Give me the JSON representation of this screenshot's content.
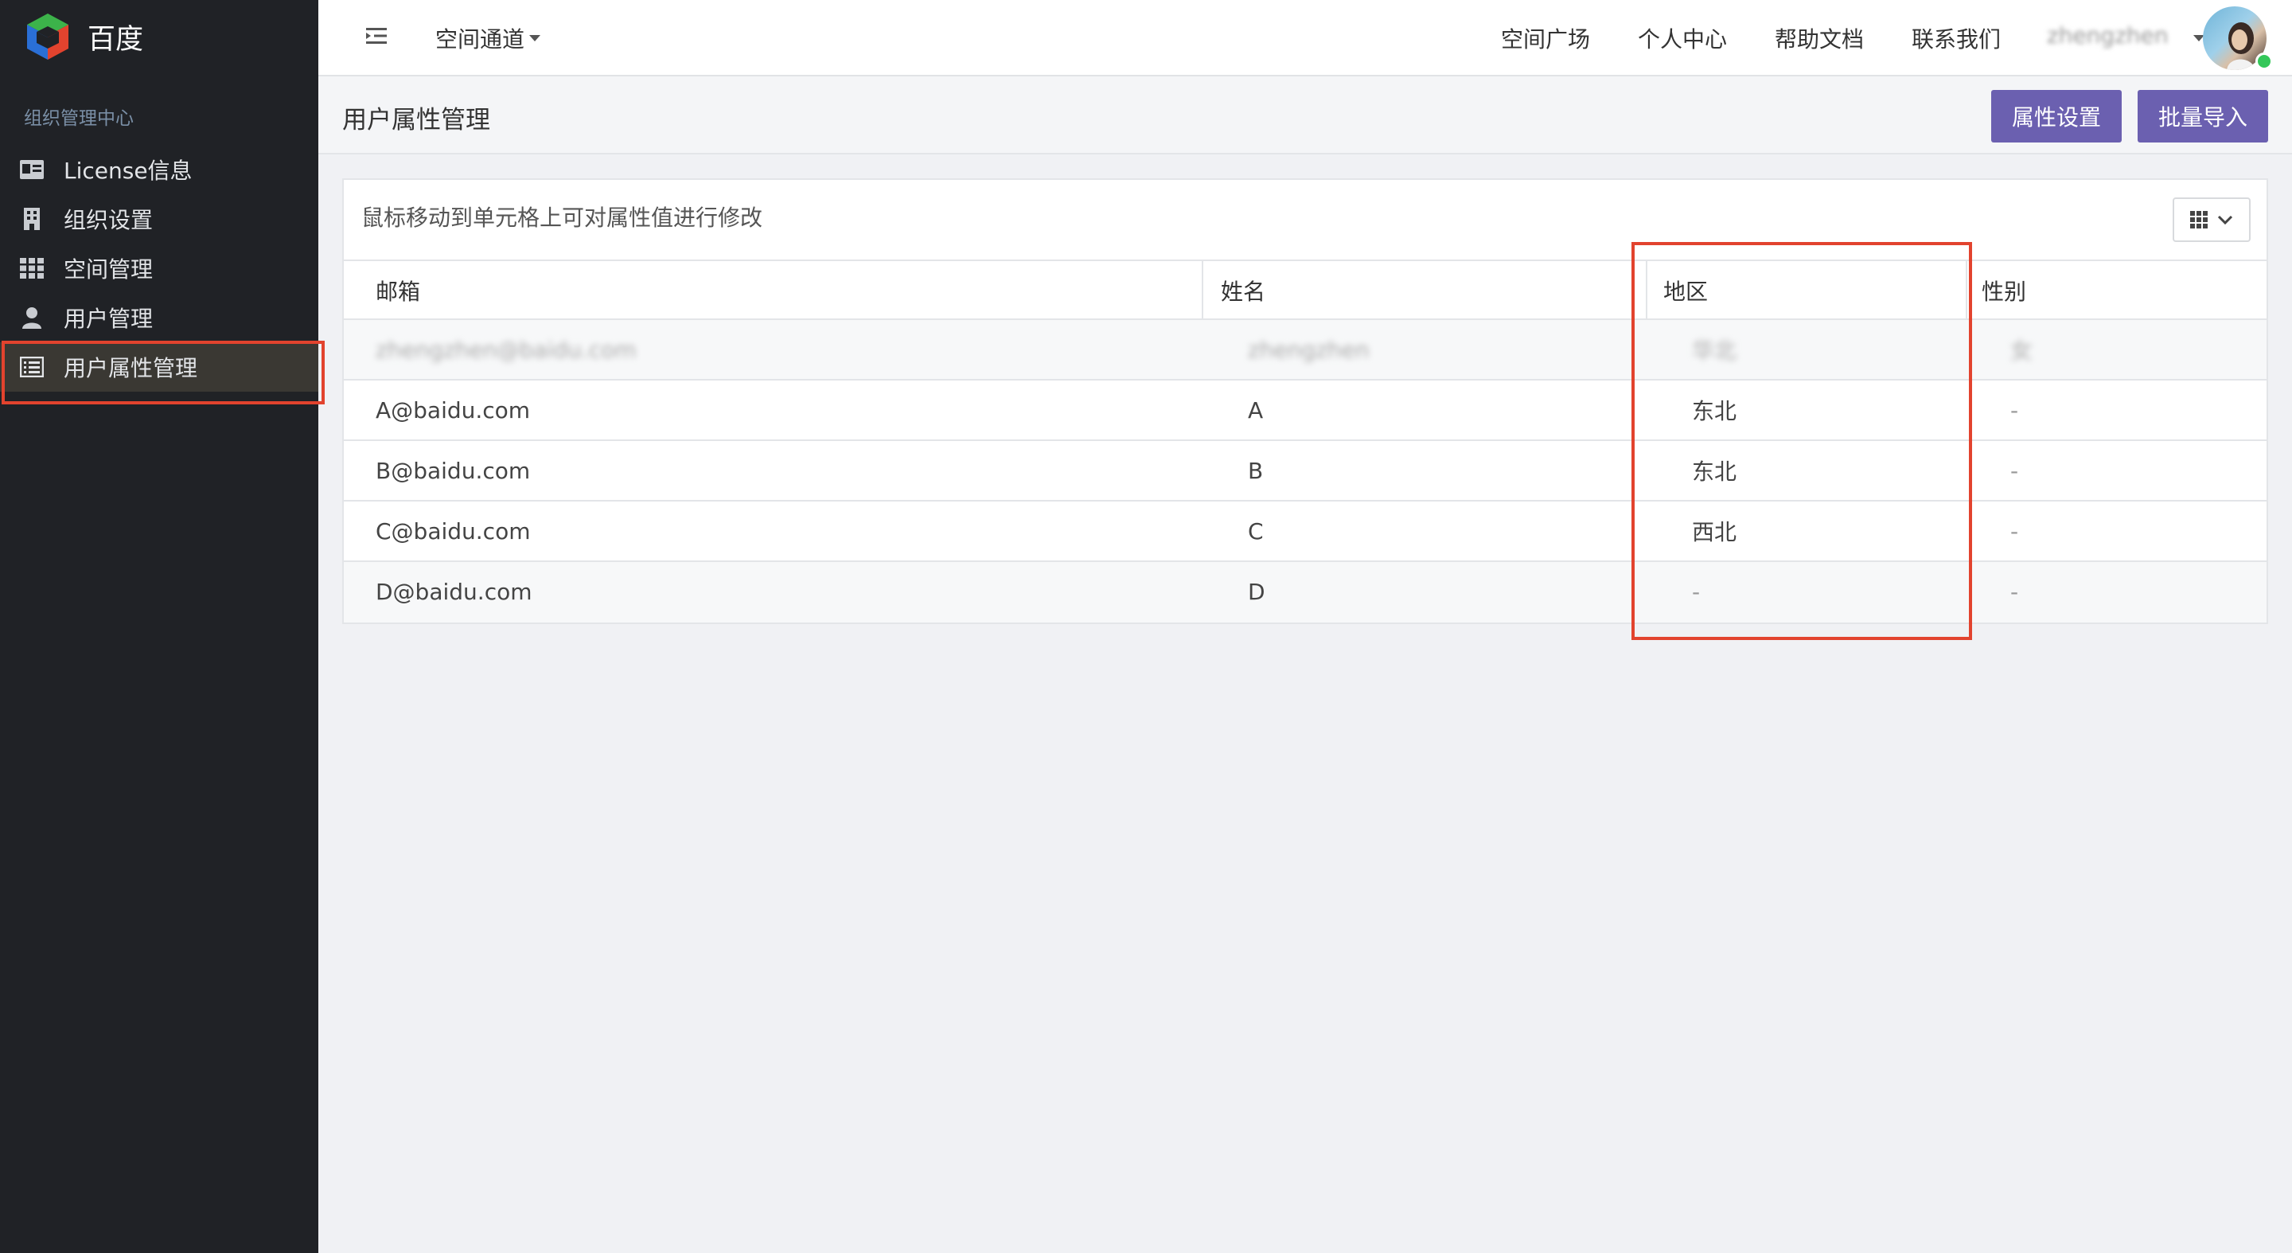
{
  "brand": {
    "name": "百度"
  },
  "sidebar": {
    "section_title": "组织管理中心",
    "items": [
      {
        "label": "License信息",
        "icon": "id-card-icon"
      },
      {
        "label": "组织设置",
        "icon": "building-icon"
      },
      {
        "label": "空间管理",
        "icon": "grid-icon"
      },
      {
        "label": "用户管理",
        "icon": "user-icon"
      },
      {
        "label": "用户属性管理",
        "icon": "list-icon",
        "active": true
      }
    ]
  },
  "topbar": {
    "channel_label": "空间通道",
    "links": [
      "空间广场",
      "个人中心",
      "帮助文档",
      "联系我们"
    ],
    "user_name": "zhengzhen"
  },
  "page": {
    "title": "用户属性管理",
    "buttons": {
      "settings": "属性设置",
      "import": "批量导入"
    }
  },
  "table": {
    "hint": "鼠标移动到单元格上可对属性值进行修改",
    "columns": [
      "邮箱",
      "姓名",
      "地区",
      "性别"
    ],
    "rows": [
      {
        "email": "zhengzhen@baidu.com",
        "name": "zhengzhen",
        "region": "华北",
        "gender": "女",
        "blurred": true
      },
      {
        "email": "A@baidu.com",
        "name": "A",
        "region": "东北",
        "gender": "-"
      },
      {
        "email": "B@baidu.com",
        "name": "B",
        "region": "东北",
        "gender": "-"
      },
      {
        "email": "C@baidu.com",
        "name": "C",
        "region": "西北",
        "gender": "-"
      },
      {
        "email": "D@baidu.com",
        "name": "D",
        "region": "-",
        "gender": "-"
      }
    ]
  },
  "colors": {
    "sidebar_bg": "#202226",
    "accent_button": "#6b60b0",
    "highlight_box": "#e2432e"
  }
}
